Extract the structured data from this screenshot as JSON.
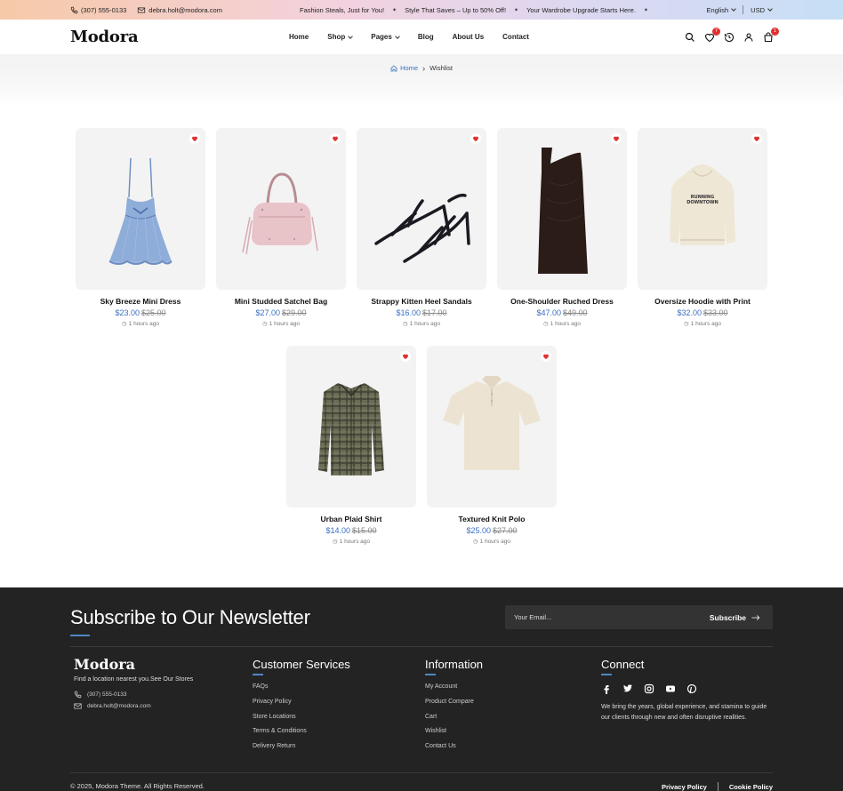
{
  "topbar": {
    "phone": "(307) 555-0133",
    "email": "debra.holt@modora.com",
    "promos": [
      "Fashion Steals, Just for You!",
      "Style That Saves – Up to 50% Off!",
      "Your Wardrobe Upgrade Starts Here."
    ],
    "language": "English",
    "currency": "USD"
  },
  "header": {
    "logo": "Modora",
    "nav": [
      {
        "label": "Home",
        "dropdown": false
      },
      {
        "label": "Shop",
        "dropdown": true
      },
      {
        "label": "Pages",
        "dropdown": true
      },
      {
        "label": "Blog",
        "dropdown": false
      },
      {
        "label": "About Us",
        "dropdown": false
      },
      {
        "label": "Contact",
        "dropdown": false
      }
    ],
    "wishlist_count": "7",
    "cart_count": "1"
  },
  "breadcrumb": {
    "home": "Home",
    "current": "Wishlist"
  },
  "products": [
    {
      "name": "Sky Breeze Mini Dress",
      "price": "$23.00",
      "old_price": "$25.00",
      "time": "1 hours ago",
      "image": "dress-blue"
    },
    {
      "name": "Mini Studded Satchel Bag",
      "price": "$27.00",
      "old_price": "$29.00",
      "time": "1 hours ago",
      "image": "bag-pink"
    },
    {
      "name": "Strappy Kitten Heel Sandals",
      "price": "$16.00",
      "old_price": "$17.00",
      "time": "1 hours ago",
      "image": "sandals-black"
    },
    {
      "name": "One-Shoulder Ruched Dress",
      "price": "$47.00",
      "old_price": "$49.00",
      "time": "1 hours ago",
      "image": "dress-brown"
    },
    {
      "name": "Oversize Hoodie with Print",
      "price": "$32.00",
      "old_price": "$33.00",
      "time": "1 hours ago",
      "image": "hoodie-cream"
    },
    {
      "name": "Urban Plaid Shirt",
      "price": "$14.00",
      "old_price": "$15.00",
      "time": "1 hours ago",
      "image": "shirt-plaid"
    },
    {
      "name": "Textured Knit Polo",
      "price": "$25.00",
      "old_price": "$27.00",
      "time": "1 hours ago",
      "image": "polo-cream"
    }
  ],
  "hoodie_print": [
    "RUNNING",
    "DOWNTOWN"
  ],
  "footer": {
    "newsletter_title": "Subscribe to Our Newsletter",
    "email_placeholder": "Your Email...",
    "subscribe_label": "Subscribe",
    "logo": "Modora",
    "find_text": "Find a location nearest you.See Our Stores",
    "phone": "(307) 555-0133",
    "email": "debra.holt@modora.com",
    "customer_services": {
      "title": "Customer Services",
      "links": [
        "FAQs",
        "Privacy Policy",
        "Store Locations",
        "Terms & Conditions",
        "Delivery Return"
      ]
    },
    "information": {
      "title": "Information",
      "links": [
        "My Account",
        "Product Compare",
        "Cart",
        "Wishlist",
        "Contact Us"
      ]
    },
    "connect": {
      "title": "Connect",
      "text": "We bring the years, global experience, and stamina to guide our clients through new and often disruptive realities."
    },
    "copyright": "© 2025, Modora Theme. All Rights Reserved.",
    "legal": [
      "Privacy Policy",
      "Cookie Policy"
    ]
  },
  "colors": {
    "accent": "#3a6fc0",
    "heart": "#e03030",
    "footer_bg": "#232323"
  }
}
